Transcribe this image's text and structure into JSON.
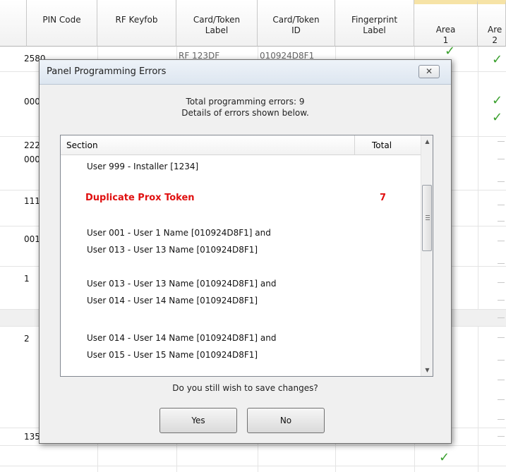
{
  "grid": {
    "headers": [
      "PIN Code",
      "RF Keyfob",
      "Card/Token\nLabel",
      "Card/Token\nID",
      "Fingerprint\nLabel",
      "Area\n1",
      "Are\n2"
    ],
    "pin_values": [
      "2580",
      "000",
      "222",
      "000",
      "111",
      "001",
      "1",
      "2",
      "135"
    ],
    "hidden_text_1": "RF 123DF",
    "hidden_text_2": "010924D8F1",
    "check_symbol": "✓"
  },
  "dialog": {
    "title": "Panel Programming Errors",
    "close_label": "✕",
    "summary_line1": "Total programming errors: 9",
    "summary_line2": "Details of errors shown below.",
    "list": {
      "col_section": "Section",
      "col_total": "Total",
      "rows": [
        "User 999 - Installer [1234]",
        "Duplicate Prox Token",
        "User 001 - User 1 Name [010924D8F1] and",
        "User 013 - User 13 Name [010924D8F1]",
        "User 013 - User 13 Name [010924D8F1] and",
        "User 014 - User 14 Name [010924D8F1]",
        "User 014 - User 14 Name [010924D8F1] and",
        "User 015 - User 15 Name [010924D8F1]"
      ],
      "error_total": "7"
    },
    "question": "Do you still wish to save changes?",
    "yes_label": "Yes",
    "no_label": "No"
  }
}
